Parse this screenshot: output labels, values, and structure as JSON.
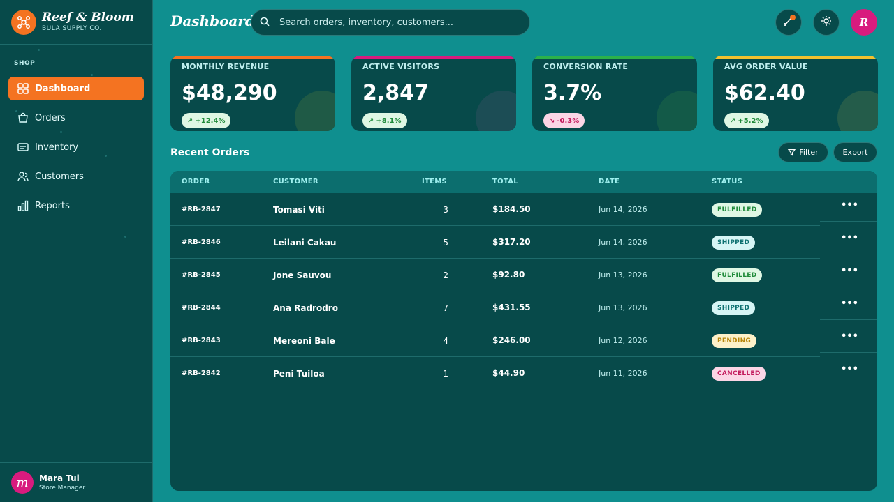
{
  "brand": {
    "name": "Reef & Bloom",
    "subtitle": "BULA SUPPLY CO."
  },
  "sidebar": {
    "section": "SHOP",
    "items": [
      {
        "label": "Dashboard",
        "icon": "grid-icon",
        "active": true
      },
      {
        "label": "Orders",
        "icon": "bag-icon",
        "active": false
      },
      {
        "label": "Inventory",
        "icon": "inventory-icon",
        "active": false
      },
      {
        "label": "Customers",
        "icon": "users-icon",
        "active": false
      },
      {
        "label": "Reports",
        "icon": "bar-chart-icon",
        "active": false
      }
    ]
  },
  "user": {
    "initial": "m",
    "name": "Mara Tui",
    "role": "Store Manager"
  },
  "header": {
    "title": "Dashboard",
    "search_placeholder": "Search orders, inventory, customers...",
    "profile_initial": "R"
  },
  "kpis": [
    {
      "label": "MONTHLY REVENUE",
      "value": "$48,290",
      "trend": "+12.4%",
      "direction": "up",
      "accent": "#f47321"
    },
    {
      "label": "ACTIVE VISITORS",
      "value": "2,847",
      "trend": "+8.1%",
      "direction": "up",
      "accent": "#d81b7e"
    },
    {
      "label": "CONVERSION RATE",
      "value": "3.7%",
      "trend": "-0.3%",
      "direction": "down",
      "accent": "#2bb14a"
    },
    {
      "label": "AVG ORDER VALUE",
      "value": "$62.40",
      "trend": "+5.2%",
      "direction": "up",
      "accent": "#f2c12e"
    }
  ],
  "orders": {
    "title": "Recent Orders",
    "filter_label": "Filter",
    "export_label": "Export",
    "columns": [
      "ORDER",
      "CUSTOMER",
      "ITEMS",
      "TOTAL",
      "DATE",
      "STATUS"
    ],
    "rows": [
      {
        "id": "#RB-2847",
        "customer": "Tomasi Viti",
        "items": "3",
        "total": "$184.50",
        "date": "Jun 14, 2026",
        "status": "FULFILLED"
      },
      {
        "id": "#RB-2846",
        "customer": "Leilani Cakau",
        "items": "5",
        "total": "$317.20",
        "date": "Jun 14, 2026",
        "status": "SHIPPED"
      },
      {
        "id": "#RB-2845",
        "customer": "Jone Sauvou",
        "items": "2",
        "total": "$92.80",
        "date": "Jun 13, 2026",
        "status": "FULFILLED"
      },
      {
        "id": "#RB-2844",
        "customer": "Ana Radrodro",
        "items": "7",
        "total": "$431.55",
        "date": "Jun 13, 2026",
        "status": "SHIPPED"
      },
      {
        "id": "#RB-2843",
        "customer": "Mereoni Bale",
        "items": "4",
        "total": "$246.00",
        "date": "Jun 12, 2026",
        "status": "PENDING"
      },
      {
        "id": "#RB-2842",
        "customer": "Peni Tuiloa",
        "items": "1",
        "total": "$44.90",
        "date": "Jun 11, 2026",
        "status": "CANCELLED"
      }
    ]
  },
  "colors": {
    "accent": "#f47321",
    "sidebar_bg": "#074a4a",
    "page_bg": "#0f8f8f",
    "brand_pink": "#d81b7e"
  }
}
